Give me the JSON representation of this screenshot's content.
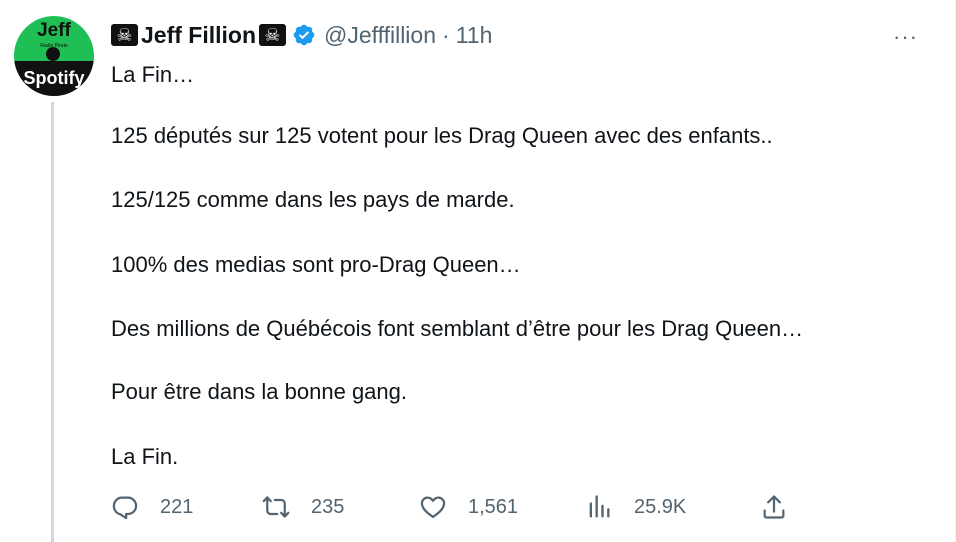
{
  "tweet": {
    "avatar": {
      "line1": "Jeff",
      "line2": "Radio Pirate",
      "line3": "Spotify"
    },
    "pirate_emoji": "☠",
    "display_name": "Jeff Fillion",
    "handle": "@Jefffillion",
    "separator": "·",
    "time": "11h",
    "more": "···",
    "lines": [
      "La Fin…",
      "125 députés sur 125 votent pour les Drag Queen avec des enfants..",
      "125/125 comme dans les pays de marde.",
      "100% des medias sont pro-Drag Queen…",
      "Des millions de Québécois font semblant d’être pour les Drag Queen…",
      "Pour être dans la bonne gang.",
      "La Fin."
    ],
    "stats": {
      "replies": "221",
      "retweets": "235",
      "likes": "1,561",
      "views": "25.9K"
    },
    "colors": {
      "secondary": "#536471",
      "verified": "#1d9bf0",
      "text": "#0f1419"
    },
    "icons": [
      "reply-icon",
      "retweet-icon",
      "like-icon",
      "views-icon",
      "share-icon",
      "verified-badge-icon",
      "more-icon"
    ]
  }
}
